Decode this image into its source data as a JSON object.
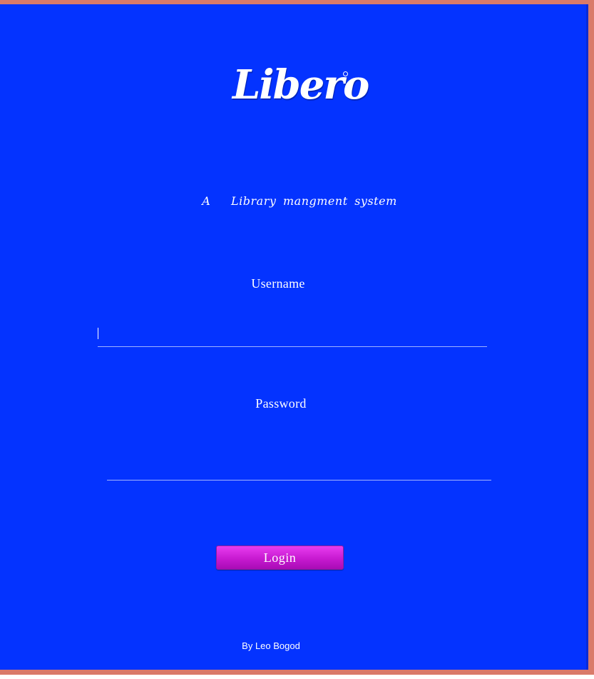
{
  "app": {
    "logo_text": "Libero",
    "subtitle": "A   Library mangment system"
  },
  "form": {
    "username_label": "Username",
    "username_value": "",
    "password_label": "Password",
    "password_value": "",
    "login_label": "Login"
  },
  "footer": {
    "credit": "By Leo Bogod"
  },
  "colors": {
    "background": "#0433ff",
    "frame": "#d97a6a",
    "button": "#c71ad0",
    "text": "#ffffff"
  }
}
